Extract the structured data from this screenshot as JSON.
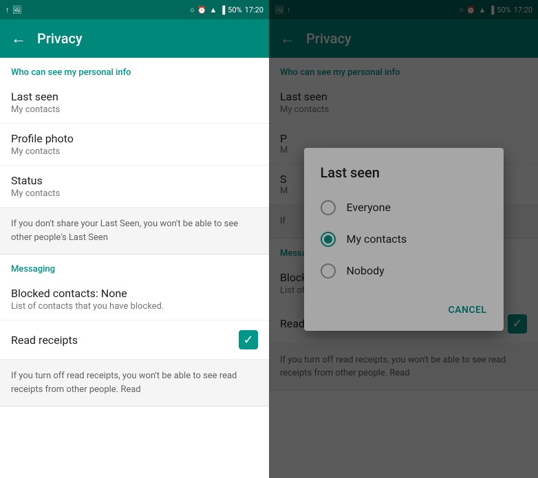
{
  "statusBar": {
    "leftIcons": [
      "↑",
      "🖼"
    ],
    "time": "17:20",
    "batteryPercent": "50%",
    "rightIcons": [
      "battery",
      "signal",
      "wifi",
      "alarm",
      "circle"
    ]
  },
  "leftPanel": {
    "header": {
      "backLabel": "←",
      "title": "Privacy"
    },
    "sections": [
      {
        "label": "Who can see my personal info",
        "items": [
          {
            "title": "Last seen",
            "sub": "My contacts"
          },
          {
            "title": "Profile photo",
            "sub": "My contacts"
          },
          {
            "title": "Status",
            "sub": "My contacts"
          }
        ]
      }
    ],
    "infoBox": "If you don't share your Last Seen, you won't be able to see other people's Last Seen",
    "messagingSection": {
      "label": "Messaging",
      "items": [
        {
          "title": "Blocked contacts: None",
          "sub": "List of contacts that you have blocked."
        }
      ]
    },
    "readReceipts": {
      "label": "Read receipts",
      "checked": true
    },
    "readReceiptsInfo": "If you turn off read receipts, you won't be able to see read receipts from other people. Read"
  },
  "rightPanel": {
    "header": {
      "backLabel": "←",
      "title": "Privacy"
    },
    "sections": [
      {
        "label": "Who can see my personal info",
        "items": [
          {
            "title": "Last seen",
            "sub": "My contacts"
          }
        ]
      }
    ],
    "messagingSection": {
      "label": "Messaging",
      "items": [
        {
          "title": "Blocked contacts: None",
          "sub": "List of contacts that you have blocked."
        }
      ]
    },
    "readReceipts": {
      "label": "Read receipts",
      "checked": true
    },
    "readReceiptsInfo": "If you turn off read receipts, you won't be able to see read receipts from other people. Read"
  },
  "modal": {
    "title": "Last seen",
    "options": [
      {
        "label": "Everyone",
        "selected": false
      },
      {
        "label": "My contacts",
        "selected": true
      },
      {
        "label": "Nobody",
        "selected": false
      }
    ],
    "cancelLabel": "CANCEL"
  },
  "colors": {
    "teal": "#009688",
    "darkTeal": "#00897b",
    "headerTeal": "#00695c"
  }
}
